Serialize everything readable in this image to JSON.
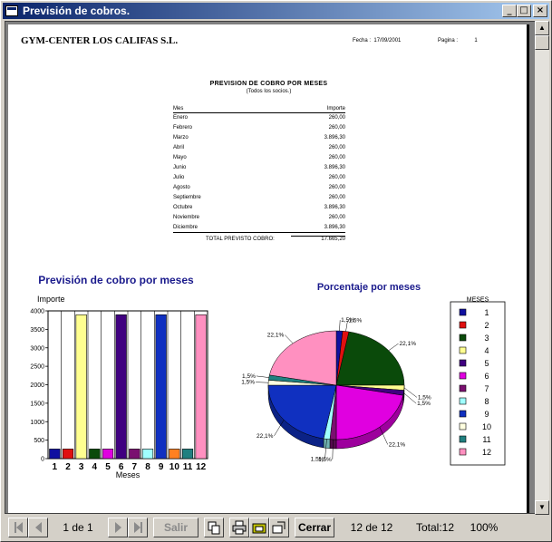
{
  "window": {
    "title": "Previsión de cobros.",
    "buttons": {
      "minimize": "_",
      "maximize": "□",
      "close": "×"
    }
  },
  "report": {
    "company": "GYM-CENTER LOS CALIFAS S.L.",
    "fecha_label": "Fecha :",
    "fecha_value": "17/09/2001",
    "pagina_label": "Pagina :",
    "pagina_value": "1",
    "title": "PREVISION DE COBRO POR MESES",
    "subtitle": "(Todos los socios.)",
    "columns": {
      "mes": "Mes",
      "importe": "Importe"
    },
    "rows": [
      {
        "mes": "Enero",
        "importe": "260,00"
      },
      {
        "mes": "Febrero",
        "importe": "260,00"
      },
      {
        "mes": "Marzo",
        "importe": "3.896,30"
      },
      {
        "mes": "Abril",
        "importe": "260,00"
      },
      {
        "mes": "Mayo",
        "importe": "260,00"
      },
      {
        "mes": "Junio",
        "importe": "3.896,30"
      },
      {
        "mes": "Julio",
        "importe": "260,00"
      },
      {
        "mes": "Agosto",
        "importe": "260,00"
      },
      {
        "mes": "Septiembre",
        "importe": "260,00"
      },
      {
        "mes": "Octubre",
        "importe": "3.896,30"
      },
      {
        "mes": "Noviembre",
        "importe": "260,00"
      },
      {
        "mes": "Diciembre",
        "importe": "3.896,30"
      }
    ],
    "total_label": "TOTAL PREVISTO COBRO:",
    "total_value": "17.665,20"
  },
  "chart_data": [
    {
      "type": "bar",
      "title": "Previsión de cobro por meses",
      "ylabel": "Importe",
      "xlabel": "Meses",
      "ylim": [
        0,
        4000
      ],
      "yticks": [
        0,
        500,
        1000,
        1500,
        2000,
        2500,
        3000,
        3500,
        4000
      ],
      "categories": [
        "1",
        "2",
        "3",
        "4",
        "5",
        "6",
        "7",
        "8",
        "9",
        "10",
        "11",
        "12"
      ],
      "values": [
        260,
        260,
        3896.3,
        260,
        260,
        3896.3,
        260,
        260,
        3896.3,
        260,
        260,
        3896.3
      ],
      "colors": [
        "#1010a0",
        "#e01010",
        "#ffff90",
        "#0a4a0a",
        "#e000e0",
        "#400080",
        "#7a1070",
        "#a0ffff",
        "#1030c0",
        "#ff8020",
        "#208080",
        "#ff90c0"
      ]
    },
    {
      "type": "pie",
      "title": "Porcentaje por meses",
      "legend_title": "MESES",
      "legend": [
        "1",
        "2",
        "3",
        "4",
        "5",
        "6",
        "7",
        "8",
        "9",
        "10",
        "11",
        "12"
      ],
      "labels": [
        "1,5%",
        "1,5%",
        "22,1%",
        "1,5%",
        "1,5%",
        "22,1%",
        "1,5%",
        "1,5%",
        "22,1%",
        "1,5%",
        "1,5%",
        "22,1%"
      ],
      "values": [
        1.5,
        1.5,
        22.1,
        1.5,
        1.5,
        22.1,
        1.5,
        1.5,
        22.1,
        1.5,
        1.5,
        22.1
      ],
      "colors": [
        "#1010a0",
        "#e01010",
        "#0a4a0a",
        "#ffff90",
        "#400080",
        "#e000e0",
        "#7a1070",
        "#a0ffff",
        "#1030c0",
        "#ffffe0",
        "#208080",
        "#ff90c0"
      ]
    }
  ],
  "toolbar": {
    "page_of": "1 de 1",
    "salir": "Salir",
    "cerrar": "Cerrar",
    "count": "12 de 12",
    "total": "Total:12",
    "zoom": "100%"
  }
}
